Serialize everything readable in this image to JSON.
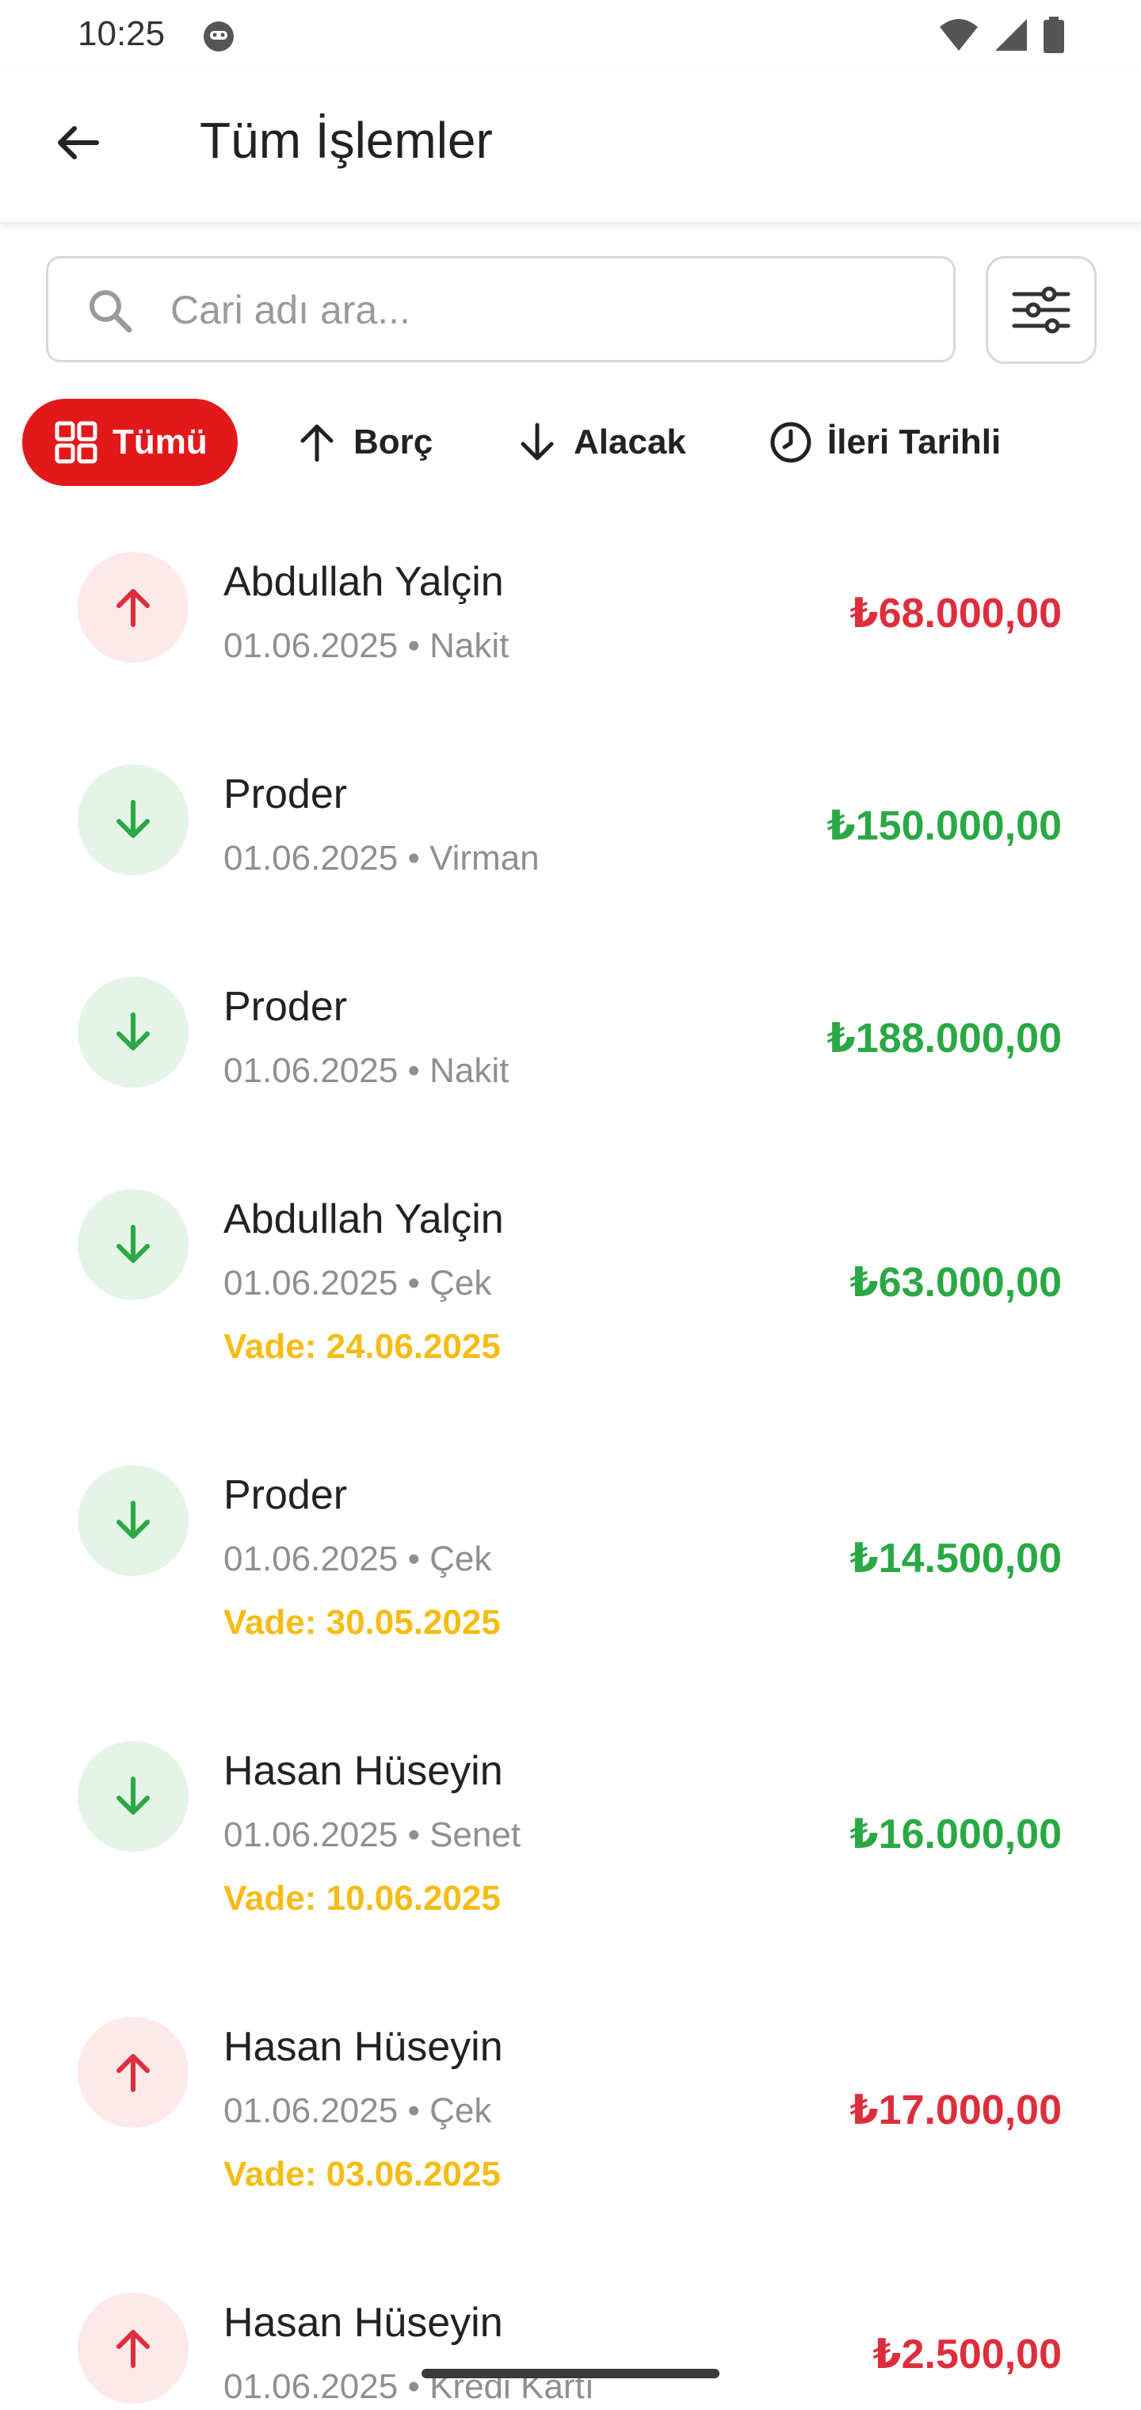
{
  "status_bar": {
    "time": "10:25"
  },
  "header": {
    "title": "Tüm İşlemler"
  },
  "search": {
    "placeholder": "Cari adı ara...",
    "value": ""
  },
  "tabs": [
    {
      "label": "Tümü",
      "icon": "grid-icon",
      "active": true
    },
    {
      "label": "Borç",
      "icon": "arrow-up-icon",
      "active": false
    },
    {
      "label": "Alacak",
      "icon": "arrow-down-icon",
      "active": false
    },
    {
      "label": "İleri Tarihli",
      "icon": "clock-icon",
      "active": false
    }
  ],
  "colors": {
    "accent": "#e3181b",
    "debit": "#de2d3c",
    "credit": "#2aa844",
    "due": "#f5bc16"
  },
  "transactions": [
    {
      "name": "Abdullah Yalçin",
      "subtitle": "01.06.2025 • Nakit",
      "amount": "₺68.000,00",
      "direction": "out",
      "due": ""
    },
    {
      "name": "Proder",
      "subtitle": "01.06.2025 • Virman",
      "amount": "₺150.000,00",
      "direction": "in",
      "due": ""
    },
    {
      "name": "Proder",
      "subtitle": "01.06.2025 • Nakit",
      "amount": "₺188.000,00",
      "direction": "in",
      "due": ""
    },
    {
      "name": "Abdullah Yalçin",
      "subtitle": "01.06.2025 • Çek",
      "amount": "₺63.000,00",
      "direction": "in",
      "due": "Vade: 24.06.2025"
    },
    {
      "name": "Proder",
      "subtitle": "01.06.2025 • Çek",
      "amount": "₺14.500,00",
      "direction": "in",
      "due": "Vade: 30.05.2025"
    },
    {
      "name": "Hasan Hüseyin",
      "subtitle": "01.06.2025 • Senet",
      "amount": "₺16.000,00",
      "direction": "in",
      "due": "Vade: 10.06.2025"
    },
    {
      "name": "Hasan Hüseyin",
      "subtitle": "01.06.2025 • Çek",
      "amount": "₺17.000,00",
      "direction": "out",
      "due": "Vade: 03.06.2025"
    },
    {
      "name": "Hasan Hüseyin",
      "subtitle": "01.06.2025 • Kredi Kartı",
      "amount": "₺2.500,00",
      "direction": "out",
      "due": ""
    }
  ]
}
